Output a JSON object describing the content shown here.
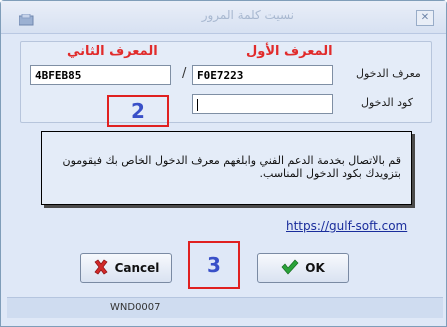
{
  "window": {
    "title": "نسيت كلمة المرور",
    "close_glyph": "✕"
  },
  "panel": {
    "header_first_id": "المعرف الأول",
    "header_second_id": "المعرف الثاني",
    "first_id_value": "F0E7223",
    "second_id_value": "4BFEB85",
    "separator": "/",
    "label_login_id": "معرف الدخول",
    "label_login_code": "كود الدخول",
    "login_code_value": ""
  },
  "markers": {
    "marker_2": "2",
    "marker_3": "3"
  },
  "message": "قم بالاتصال بخدمة الدعم الفني وابلغهم معرف الدخول الخاص بك فيقومون بتزويدك بكود الدخول المناسب.",
  "link_text": "https://gulf-soft.com",
  "buttons": {
    "cancel": "Cancel",
    "ok": "OK"
  },
  "status": {
    "code": "WND0007"
  },
  "colors": {
    "header_red": "#e12b2b",
    "marker_red": "#e02020",
    "marker_text": "#3950c8"
  }
}
